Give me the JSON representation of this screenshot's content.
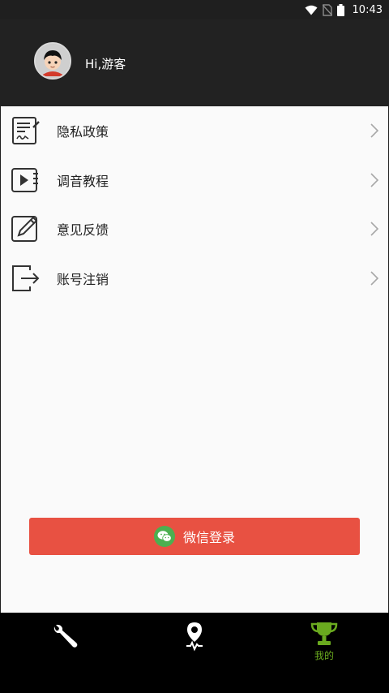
{
  "status_bar": {
    "time": "10:43",
    "icons": [
      "wifi-icon",
      "no-sim-icon",
      "battery-icon"
    ]
  },
  "header": {
    "greeting": "Hi,游客",
    "avatar_icon": "avatar-icon"
  },
  "menu": {
    "items": [
      {
        "label": "隐私政策",
        "icon": "privacy-document-icon"
      },
      {
        "label": "调音教程",
        "icon": "video-tutorial-icon"
      },
      {
        "label": "意见反馈",
        "icon": "feedback-pencil-icon"
      },
      {
        "label": "账号注销",
        "icon": "logout-icon"
      }
    ]
  },
  "login": {
    "label": "微信登录",
    "icon": "wechat-icon",
    "color": "#e85142"
  },
  "bottom_nav": {
    "tabs": [
      {
        "label": "",
        "icon": "wrench-icon"
      },
      {
        "label": "",
        "icon": "location-pin-icon"
      },
      {
        "label": "我的",
        "icon": "trophy-icon",
        "active": true
      }
    ],
    "active_color": "#6aaa1f"
  }
}
